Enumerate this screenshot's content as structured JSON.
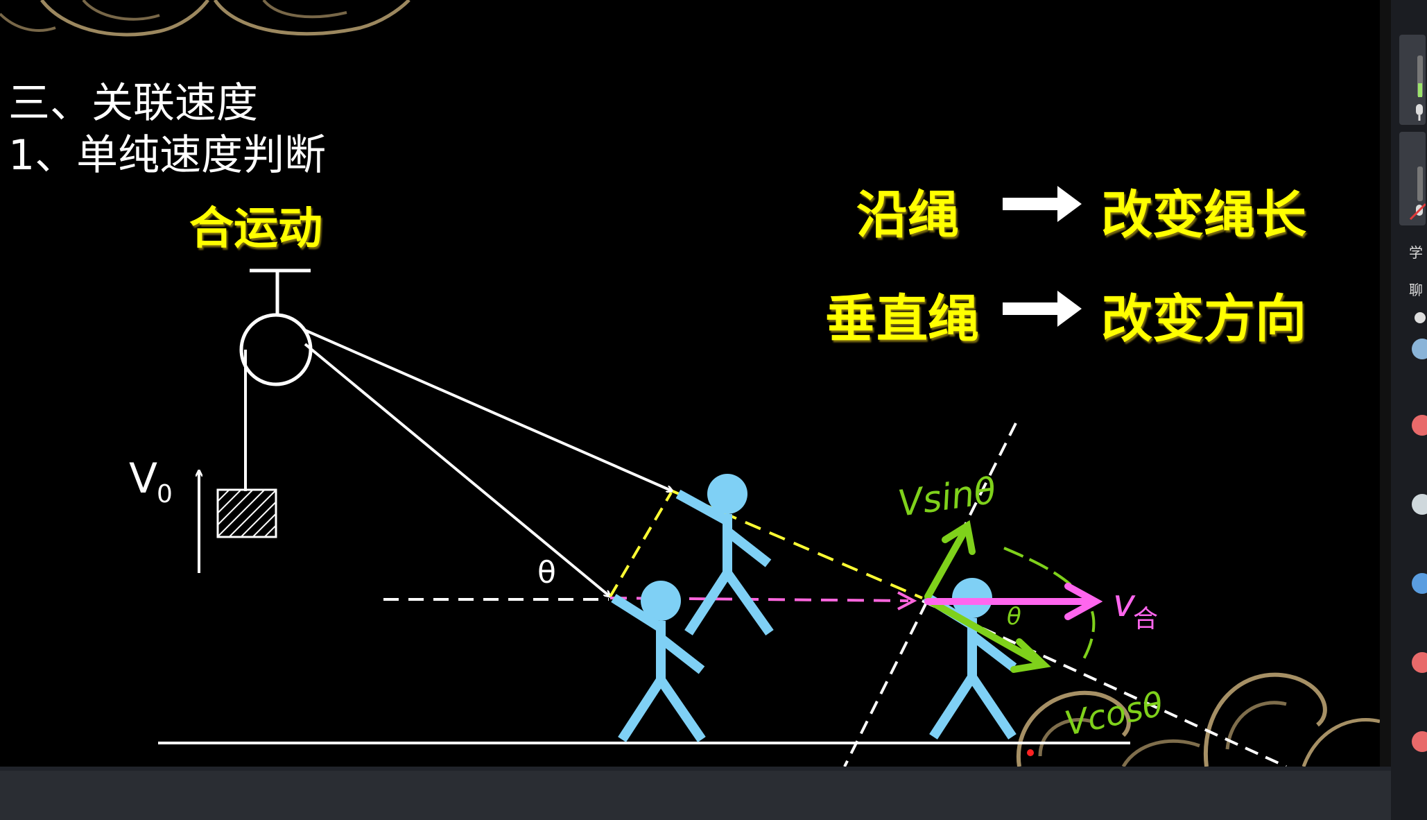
{
  "slide": {
    "heading": "三、关联速度",
    "subheading": "1、单纯速度判断",
    "label_combined_motion": "合运动",
    "rule_row_1": {
      "left": "沿绳",
      "right": "改变绳长"
    },
    "rule_row_2": {
      "left": "垂直绳",
      "right": "改变方向"
    },
    "label_v0": "V",
    "label_v0_sub": "0",
    "label_theta": "θ",
    "label_vhe": "v",
    "label_vhe_sub": "合",
    "annot_vsin": "Vsinθ",
    "annot_vcos": "Vcosθ",
    "annot_theta_small": "θ",
    "colors": {
      "text_yellow": "#ffff00",
      "figure_blue": "#7fd0f5",
      "rope_white": "#ffffff",
      "dash_yellow": "#ffff33",
      "dash_pink": "#ff66dd",
      "arrow_pink": "#ff66ee",
      "ink_green": "#7fd11b"
    }
  },
  "side_panel": {
    "label_1": "学",
    "label_2": "聊"
  }
}
